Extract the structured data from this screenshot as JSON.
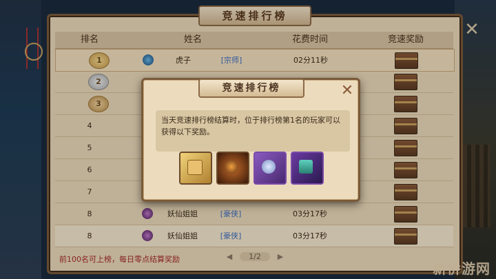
{
  "header": {
    "title": "竞速排行榜"
  },
  "table": {
    "columns": [
      "排名",
      "姓名",
      "花费时间",
      "竞速奖励"
    ],
    "rows": [
      {
        "rank": "1",
        "name": "虎子",
        "sect": "[宗师]",
        "time": "02分11秒"
      },
      {
        "rank": "2",
        "name": "",
        "sect": "",
        "time": ""
      },
      {
        "rank": "3",
        "name": "",
        "sect": "",
        "time": ""
      },
      {
        "rank": "4",
        "name": "",
        "sect": "",
        "time": ""
      },
      {
        "rank": "5",
        "name": "",
        "sect": "",
        "time": ""
      },
      {
        "rank": "6",
        "name": "",
        "sect": "",
        "time": ""
      },
      {
        "rank": "7",
        "name": "",
        "sect": "",
        "time": ""
      },
      {
        "rank": "8",
        "name": "妖仙姐姐",
        "sect": "[豪侠]",
        "time": "03分17秒"
      },
      {
        "rank": "8",
        "name": "妖仙姐姐",
        "sect": "[豪侠]",
        "time": "03分17秒"
      }
    ]
  },
  "footer": {
    "note": "前100名可上榜，每日零点结算奖励"
  },
  "pager": {
    "prev": "◀",
    "page": "1/2",
    "next": "▶"
  },
  "popup": {
    "title": "竞速排行榜",
    "close": "✕",
    "description": "当天竞速排行榜结算时，位于排行榜第1名的玩家可以获得以下奖励。",
    "rewards": [
      "scroll-icon",
      "orb-icon",
      "pearl-icon",
      "chest-icon"
    ]
  },
  "colors": {
    "panel": "#e9d8b9",
    "border": "#7a5a3a",
    "accent_red": "#a52a2a",
    "sect_blue": "#3b6bbf"
  },
  "watermark": "新侨游网"
}
